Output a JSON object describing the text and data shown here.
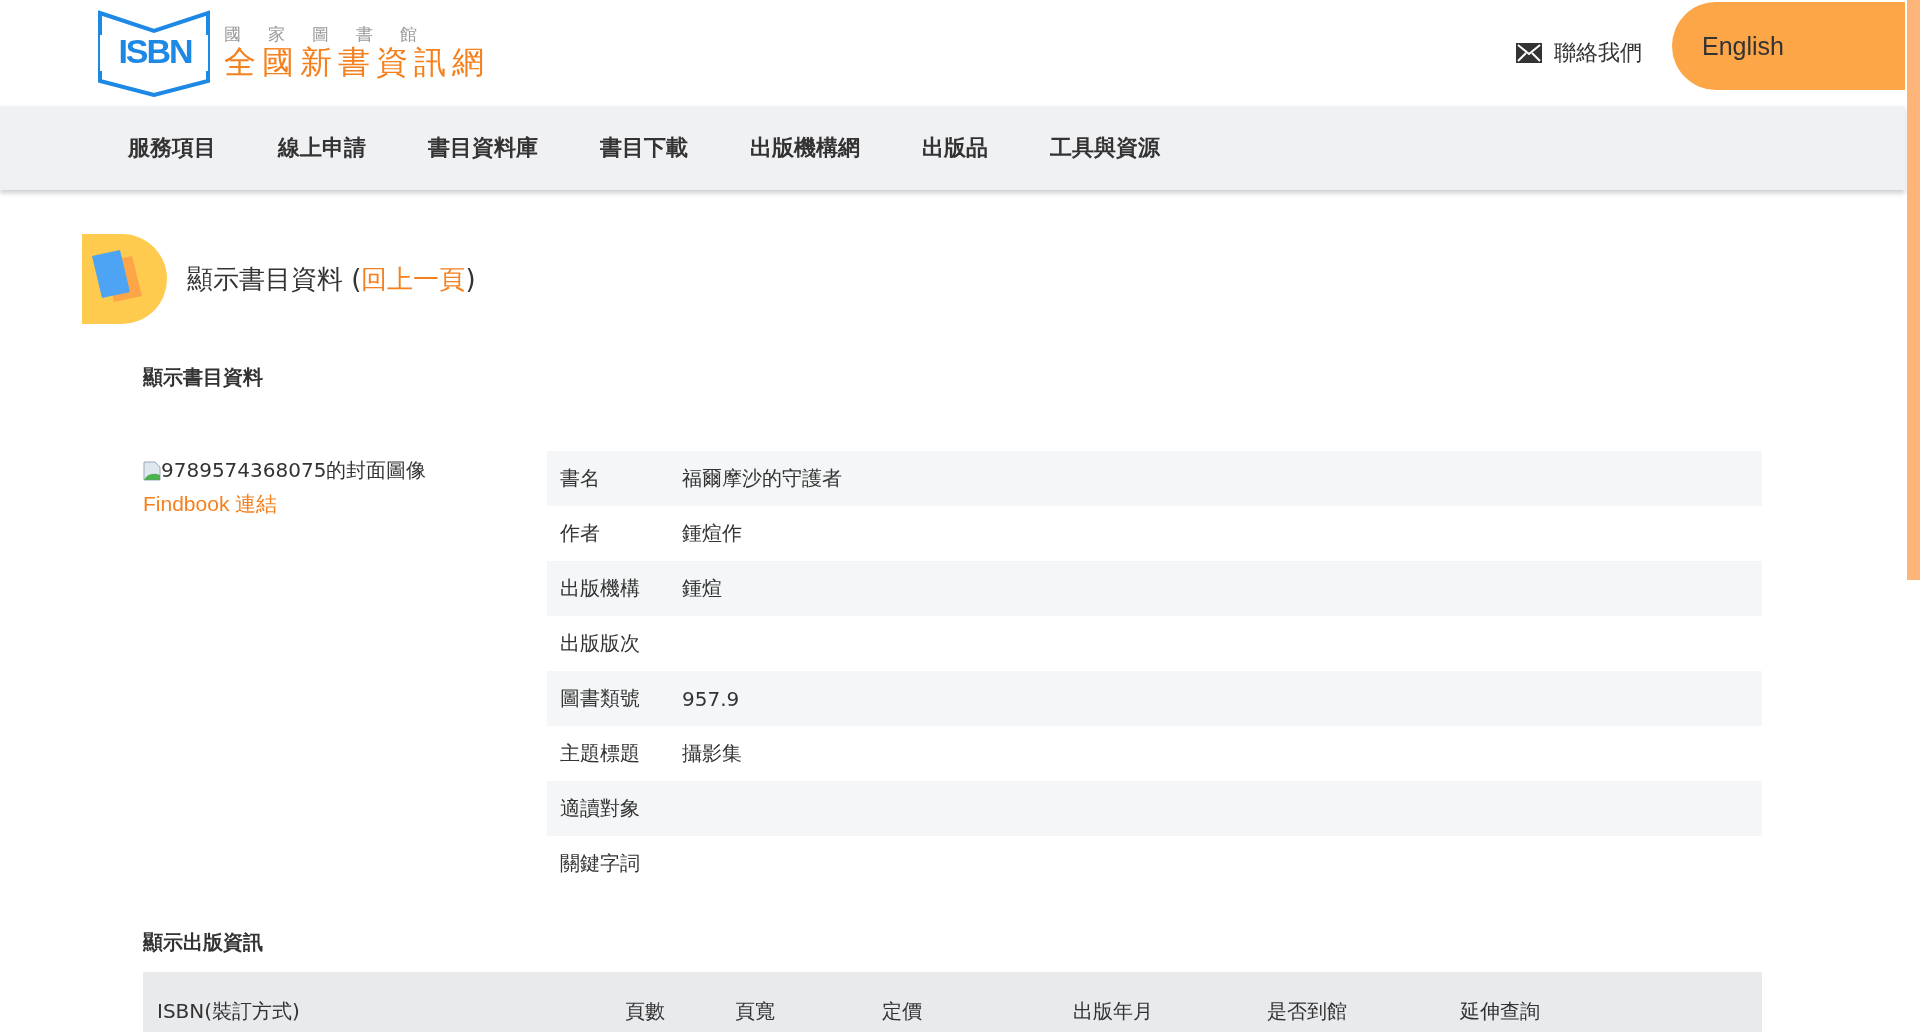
{
  "header": {
    "logo": {
      "mark": "ISBN",
      "subtitle": "國家圖書館",
      "title": "全國新書資訊網"
    },
    "contact": "聯絡我們",
    "language": "English"
  },
  "nav": [
    "服務項目",
    "線上申請",
    "書目資料庫",
    "書目下載",
    "出版機構網",
    "出版品",
    "工具與資源"
  ],
  "page_title": {
    "text": "顯示書目資料",
    "open": "(",
    "link": "回上一頁",
    "close": ")"
  },
  "book_section": {
    "heading": "顯示書目資料",
    "cover_alt": "9789574368075的封面圖像",
    "findbook_link": "Findbook 連結",
    "fields": [
      {
        "label": "書名",
        "value": "福爾摩沙的守護者"
      },
      {
        "label": "作者",
        "value": "鍾煊作"
      },
      {
        "label": "出版機構",
        "value": "鍾煊"
      },
      {
        "label": "出版版次"
      },
      {
        "label": "圖書類號",
        "value": "957.9"
      },
      {
        "label": "主題標題",
        "value": "攝影集"
      },
      {
        "label": "適讀對象"
      },
      {
        "label": "關鍵字詞"
      }
    ]
  },
  "publication_section": {
    "heading": "顯示出版資訊",
    "table": {
      "columns": [
        "ISBN(裝訂方式)",
        "頁數",
        "頁寬",
        "定價",
        "出版年月",
        "是否到館",
        "延伸查詢"
      ]
    }
  }
}
